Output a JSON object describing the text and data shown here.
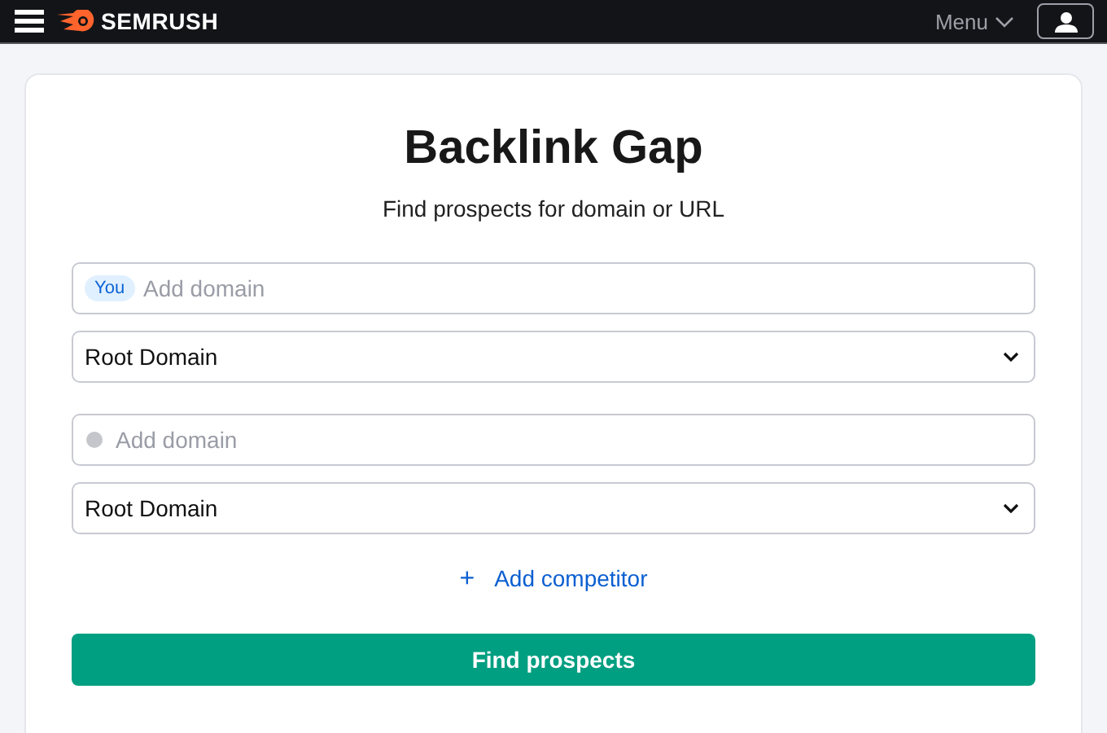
{
  "header": {
    "logo": "SEMRUSH",
    "menu": "Menu"
  },
  "title": "Backlink Gap",
  "subtitle": "Find prospects for domain or URL",
  "domains": [
    {
      "badge": "You",
      "placeholder": "Add domain",
      "scope": "Root Domain"
    },
    {
      "placeholder": "Add domain",
      "scope": "Root Domain"
    }
  ],
  "add_competitor": {
    "icon": "+",
    "label": "Add competitor"
  },
  "submit": "Find prospects"
}
